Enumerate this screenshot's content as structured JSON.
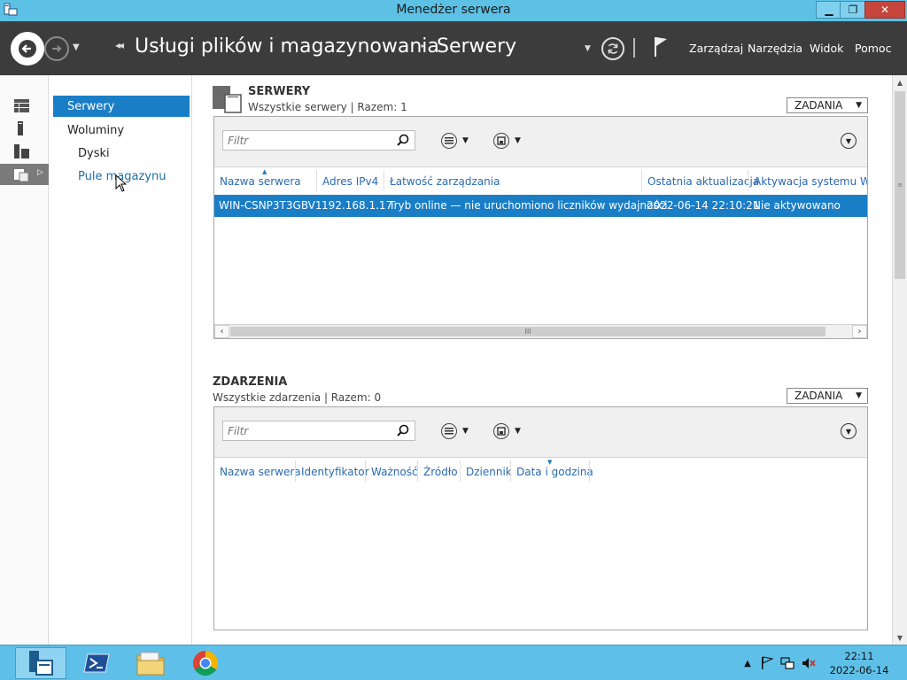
{
  "window": {
    "title": "Menedżer serwera",
    "controls": {
      "minimize": "▁",
      "maximize": "❐",
      "close": "✕"
    }
  },
  "breadcrumb": {
    "part1": "Usługi plików i magazynowania",
    "separator": "‣",
    "part2": "Serwery"
  },
  "menu": [
    "Zarządzaj",
    "Narzędzia",
    "Widok",
    "Pomoc"
  ],
  "icons": {
    "back": "back-arrow-icon",
    "forward": "forward-arrow-icon",
    "refresh": "refresh-icon",
    "flag": "notifications-flag-icon"
  },
  "rail": [
    "dashboard-icon",
    "local-server-icon",
    "all-servers-icon",
    "file-services-icon"
  ],
  "navtree": {
    "servers": "Serwery",
    "volumes": "Woluminy",
    "disks": "Dyski",
    "pools": "Pule magazynu"
  },
  "servers_section": {
    "title": "SERWERY",
    "subtitle": "Wszystkie serwery | Razem: 1",
    "tasks": "ZADANIA",
    "filter_placeholder": "Filtr",
    "columns": [
      "Nazwa serwera",
      "Adres IPv4",
      "Łatwość zarządzania",
      "Ostatnia aktualizacja",
      "Aktywacja systemu Wind"
    ],
    "rows": [
      [
        "WIN-CSNP3T3GBV1",
        "192.168.1.17",
        "Tryb online — nie uruchomiono liczników wydajności",
        "2022-06-14 22:10:21",
        "Nie aktywowano"
      ]
    ],
    "hscroll_grip": "III"
  },
  "events_section": {
    "title": "ZDARZENIA",
    "subtitle": "Wszystkie zdarzenia | Razem: 0",
    "tasks": "ZADANIA",
    "filter_placeholder": "Filtr",
    "columns": [
      "Nazwa serwera",
      "Identyfikator",
      "Ważność",
      "Źródło",
      "Dziennik",
      "Data i godzina"
    ]
  },
  "vscroll_grip": "≡",
  "taskbar": {
    "apps": [
      "server-manager-icon",
      "powershell-icon",
      "file-explorer-icon",
      "chrome-icon"
    ],
    "clock_time": "22:11",
    "clock_date": "2022-06-14"
  },
  "colors": {
    "accent": "#1a7ec7",
    "titlebar": "#5dc1e6",
    "commandbar": "#3c3c3c",
    "taskbar": "#5ec0e8",
    "link": "#2a6ab0"
  }
}
